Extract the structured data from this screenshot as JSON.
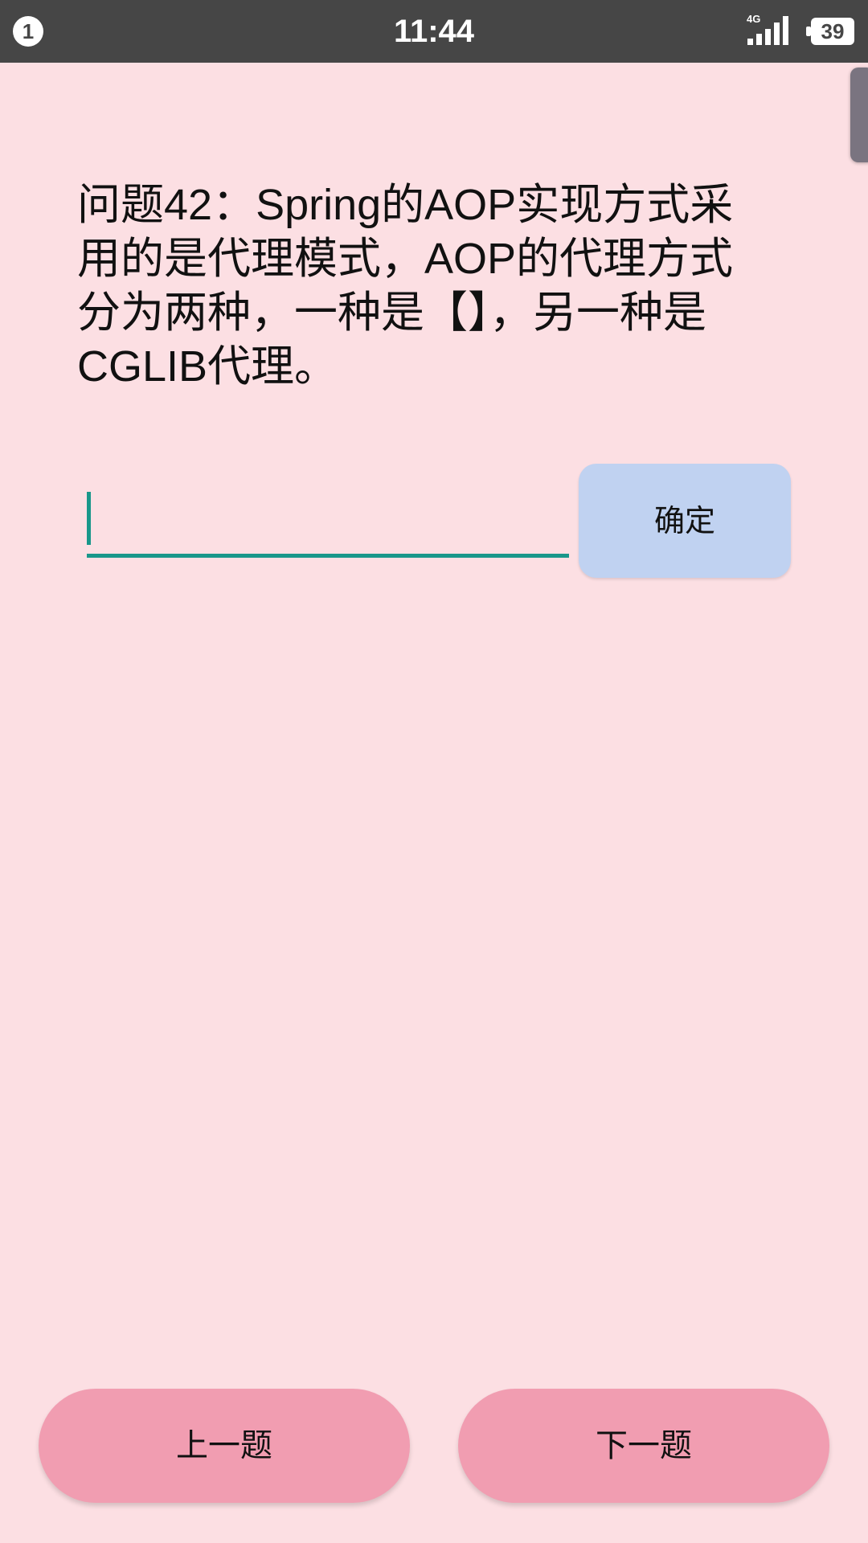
{
  "status_bar": {
    "notification_count": "1",
    "time": "11:44",
    "network": "4G",
    "battery": "39",
    "icons": [
      "signal-icon",
      "battery-icon"
    ]
  },
  "question": {
    "text": "问题42：Spring的AOP实现方式采用的是代理模式，AOP的代理方式分为两种，一种是【】，另一种是CGLIB代理。"
  },
  "answer_input": {
    "value": "",
    "placeholder": ""
  },
  "confirm_label": "确定",
  "nav": {
    "prev_label": "上一题",
    "next_label": "下一题"
  },
  "colors": {
    "background": "#fcdfe3",
    "status_bar": "#464646",
    "accent": "#19978a",
    "confirm_button": "#c0d2f1",
    "nav_button": "#f19db1"
  }
}
